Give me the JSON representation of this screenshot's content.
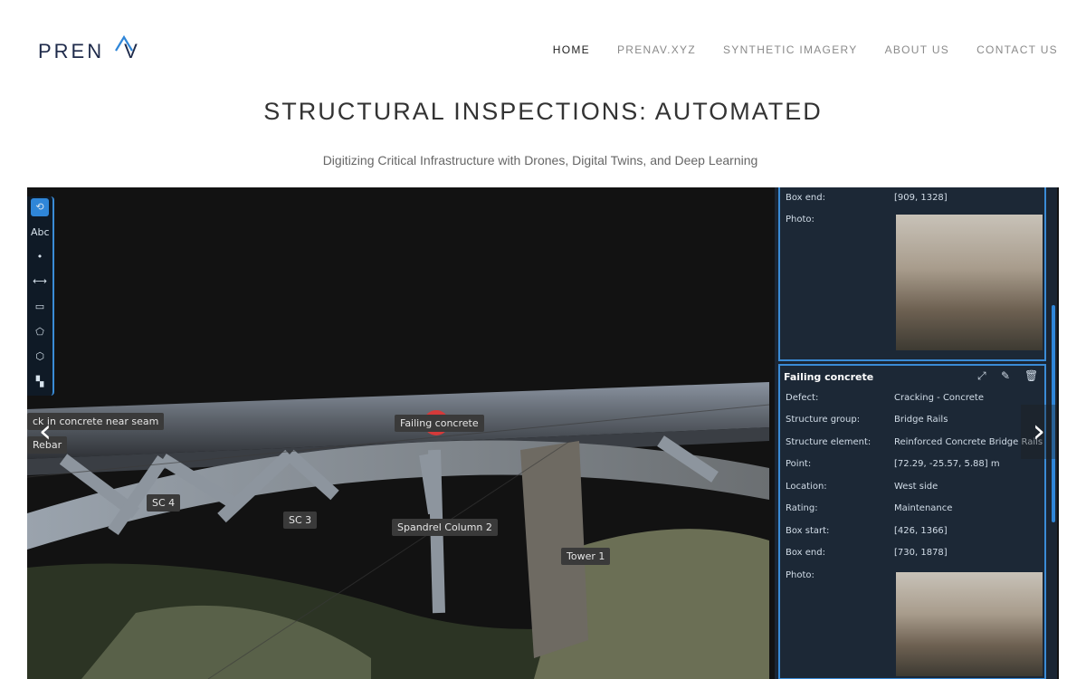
{
  "header": {
    "logo_text": "PREN",
    "logo_suffix": "V",
    "nav": [
      {
        "label": "HOME",
        "active": true
      },
      {
        "label": "PRENAV.XYZ",
        "active": false
      },
      {
        "label": "SYNTHETIC IMAGERY",
        "active": false
      },
      {
        "label": "ABOUT US",
        "active": false
      },
      {
        "label": "CONTACT US",
        "active": false
      }
    ]
  },
  "hero": {
    "title": "STRUCTURAL INSPECTIONS: AUTOMATED",
    "subtitle": "Digitizing Critical Infrastructure with Drones, Digital Twins, and Deep Learning"
  },
  "scene": {
    "labels": [
      {
        "text": "ck in concrete near seam"
      },
      {
        "text": "Rebar"
      },
      {
        "text": "Failing concrete"
      },
      {
        "text": "SC 4"
      },
      {
        "text": "SC 3"
      },
      {
        "text": "Spandrel Column 2"
      },
      {
        "text": "Tower 1"
      }
    ],
    "toolbar": [
      {
        "icon": "rotate-icon",
        "glyph": "⟲"
      },
      {
        "icon": "text-icon",
        "glyph": "Abc"
      },
      {
        "icon": "point-icon",
        "glyph": "•"
      },
      {
        "icon": "measure-icon",
        "glyph": "⟷"
      },
      {
        "icon": "rectangle-icon",
        "glyph": "▭"
      },
      {
        "icon": "polygon-icon",
        "glyph": "⬠"
      },
      {
        "icon": "cube-icon",
        "glyph": "⬡"
      },
      {
        "icon": "checker-icon",
        "glyph": "▚"
      }
    ]
  },
  "panel": {
    "card1": {
      "box_end_label": "Box end:",
      "box_end_value": "[909, 1328]",
      "photo_label": "Photo:"
    },
    "card2": {
      "title": "Failing concrete",
      "fields": [
        {
          "label": "Defect:",
          "value": "Cracking - Concrete"
        },
        {
          "label": "Structure group:",
          "value": "Bridge Rails"
        },
        {
          "label": "Structure element:",
          "value": "Reinforced Concrete Bridge Rails"
        },
        {
          "label": "Point:",
          "value": "[72.29, -25.57, 5.88] m"
        },
        {
          "label": "Location:",
          "value": "West side"
        },
        {
          "label": "Rating:",
          "value": "Maintenance"
        },
        {
          "label": "Box start:",
          "value": "[426, 1366]"
        },
        {
          "label": "Box end:",
          "value": "[730, 1878]"
        },
        {
          "label": "Photo:",
          "value": ""
        }
      ]
    }
  },
  "slider": {
    "prev": "‹",
    "next": "›"
  }
}
